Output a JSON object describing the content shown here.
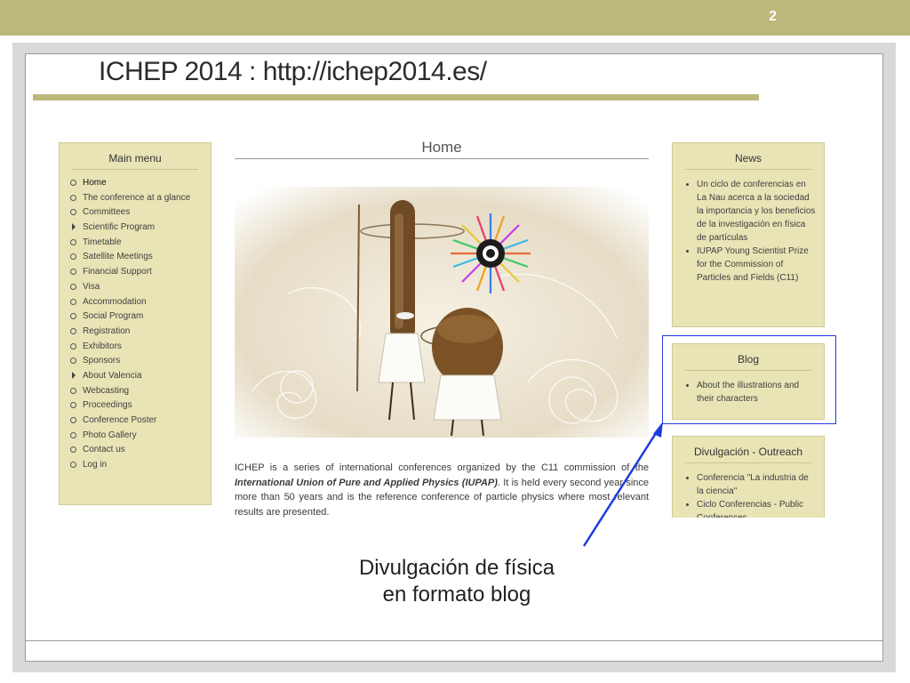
{
  "slide": {
    "number": "2",
    "title": "ICHEP 2014 : http://ichep2014.es/",
    "accent_color": "#bcb87c",
    "callout_line1": "Divulgación de física",
    "callout_line2": "en formato blog",
    "highlight_color": "#1f3adf"
  },
  "website": {
    "main_menu": {
      "title": "Main menu",
      "items": [
        {
          "label": "Home",
          "icon": "circle-bullet"
        },
        {
          "label": "The conference at a glance",
          "icon": "circle-bullet"
        },
        {
          "label": "Committees",
          "icon": "circle-bullet"
        },
        {
          "label": "Scientific Program",
          "icon": "triangle-expand-icon"
        },
        {
          "label": "Timetable",
          "icon": "circle-bullet"
        },
        {
          "label": "Satellite Meetings",
          "icon": "circle-bullet"
        },
        {
          "label": "Financial Support",
          "icon": "circle-bullet"
        },
        {
          "label": "Visa",
          "icon": "circle-bullet"
        },
        {
          "label": "Accommodation",
          "icon": "circle-bullet"
        },
        {
          "label": "Social Program",
          "icon": "circle-bullet"
        },
        {
          "label": "Registration",
          "icon": "circle-bullet"
        },
        {
          "label": "Exhibitors",
          "icon": "circle-bullet"
        },
        {
          "label": "Sponsors",
          "icon": "circle-bullet"
        },
        {
          "label": "About Valencia",
          "icon": "triangle-expand-icon"
        },
        {
          "label": "Webcasting",
          "icon": "circle-bullet"
        },
        {
          "label": "Proceedings",
          "icon": "circle-bullet"
        },
        {
          "label": "Conference Poster",
          "icon": "circle-bullet"
        },
        {
          "label": "Photo Gallery",
          "icon": "circle-bullet"
        },
        {
          "label": "Contact us",
          "icon": "circle-bullet"
        },
        {
          "label": "Log in",
          "icon": "circle-bullet"
        }
      ]
    },
    "home": {
      "title": "Home",
      "para_1": "ICHEP is a series of international conferences organized by the C11 commission of the ",
      "para_bold": "International Union of Pure and Applied Physics (IUPAP)",
      "para_2": ". It is held every second year since more than 50 years and is the reference conference of particle physics where most relevant results are presented."
    },
    "news": {
      "title": "News",
      "items": [
        "Un ciclo de conferencias en La Nau acerca a la sociedad la importancia y los beneficios de la investigación en física de partículas",
        "IUPAP Young Scientist Prize for the Commission of Particles and Fields (C11)"
      ]
    },
    "blog": {
      "title": "Blog",
      "items": [
        "About the illustrations and their characters"
      ]
    },
    "divulgacion": {
      "title": "Divulgación - Outreach",
      "items": [
        "Conferencia \"La industria de la ciencia\"",
        "Ciclo Conferencias - Public Conferences"
      ]
    }
  }
}
